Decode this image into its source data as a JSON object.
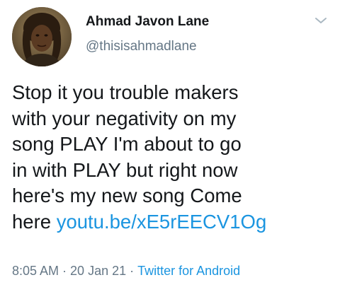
{
  "author": {
    "display_name": "Ahmad Javon Lane",
    "handle": "@thisisahmadlane",
    "avatar_icon": "profile-photo"
  },
  "menu": {
    "icon": "chevron-down-icon"
  },
  "tweet": {
    "text_lines": [
      "Stop it you trouble makers",
      "with your negativity on my",
      "song PLAY I'm about to go",
      "in with PLAY but right now",
      "here's my new song Come",
      "here"
    ],
    "link_text": "youtu.be/xE5rEECV1Og"
  },
  "meta": {
    "time": "8:05 AM",
    "separator": "·",
    "date": "20 Jan 21",
    "source": "Twitter for Android"
  },
  "colors": {
    "link": "#1b95e0",
    "secondary_text": "#657786",
    "primary_text": "#14171a"
  }
}
